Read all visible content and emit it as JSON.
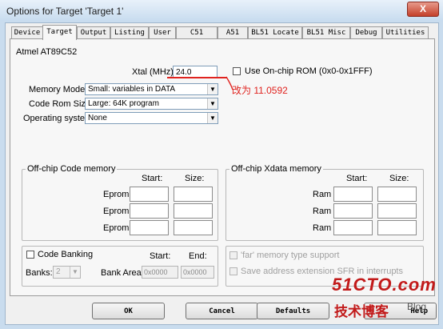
{
  "window": {
    "title": "Options for Target 'Target 1'",
    "close_symbol": "X"
  },
  "tabs": [
    {
      "label": "Device"
    },
    {
      "label": "Target"
    },
    {
      "label": "Output"
    },
    {
      "label": "Listing"
    },
    {
      "label": "User"
    },
    {
      "label": "C51"
    },
    {
      "label": "A51"
    },
    {
      "label": "BL51 Locate"
    },
    {
      "label": "BL51 Misc"
    },
    {
      "label": "Debug"
    },
    {
      "label": "Utilities"
    }
  ],
  "device_name": "Atmel AT89C52",
  "xtal": {
    "label": "Xtal (MHz):",
    "value": "24.0"
  },
  "onchip_rom": {
    "label": "Use On-chip ROM (0x0-0x1FFF)",
    "checked": false
  },
  "memory_model": {
    "label": "Memory Model:",
    "value": "Small: variables in DATA"
  },
  "code_rom_size": {
    "label": "Code Rom Size:",
    "value": "Large: 64K program"
  },
  "operating_system": {
    "label": "Operating system:",
    "value": "None"
  },
  "annotation": "改为 11.0592",
  "offchip_code": {
    "title": "Off-chip Code memory",
    "start_header": "Start:",
    "size_header": "Size:",
    "rows": [
      {
        "label": "Eprom",
        "start": "",
        "size": ""
      },
      {
        "label": "Eprom",
        "start": "",
        "size": ""
      },
      {
        "label": "Eprom",
        "start": "",
        "size": ""
      }
    ]
  },
  "offchip_xdata": {
    "title": "Off-chip Xdata memory",
    "start_header": "Start:",
    "size_header": "Size:",
    "rows": [
      {
        "label": "Ram",
        "start": "",
        "size": ""
      },
      {
        "label": "Ram",
        "start": "",
        "size": ""
      },
      {
        "label": "Ram",
        "start": "",
        "size": ""
      }
    ]
  },
  "code_banking": {
    "label": "Code Banking",
    "checked": false,
    "start_header": "Start:",
    "end_header": "End:",
    "banks_label": "Banks:",
    "banks_value": "2",
    "bank_area_label": "Bank Area:",
    "bank_area_start": "0x0000",
    "bank_area_end": "0x0000"
  },
  "far_memory": {
    "label": "'far' memory type support",
    "checked": false
  },
  "save_sfr": {
    "label": "Save address extension SFR in interrupts",
    "checked": false
  },
  "buttons": {
    "ok": "OK",
    "cancel": "Cancel",
    "defaults": "Defaults",
    "help": "Help"
  },
  "watermark": {
    "site": "51CTO.com",
    "blog": "技术博客",
    "blog_en": "Blog"
  },
  "colors": {
    "annotation_red": "#e0231f",
    "watermark_red": "#c21a1a"
  }
}
